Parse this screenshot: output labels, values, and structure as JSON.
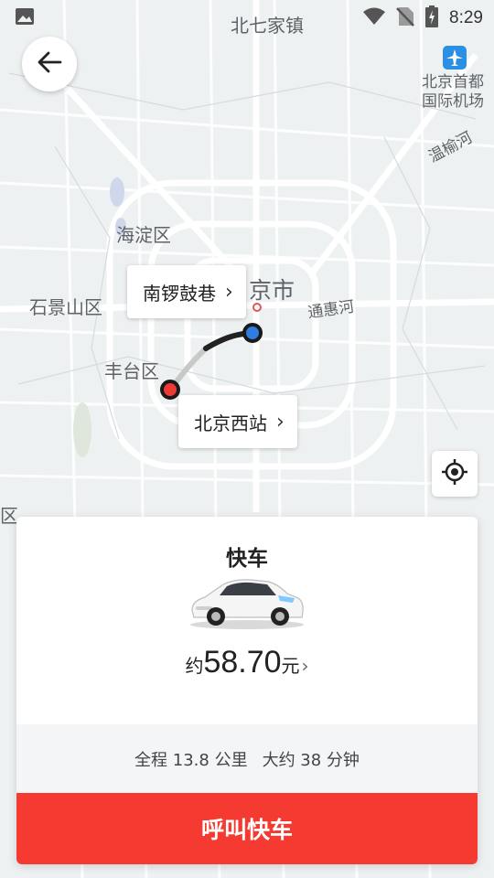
{
  "status_bar": {
    "time": "8:29"
  },
  "map": {
    "labels": {
      "beiqijia": "北七家镇",
      "airport": "北京首都\n国际机场",
      "wenyu": "温榆河",
      "haidian": "海淀区",
      "beijing": "京市",
      "shijingshan": "石景山区",
      "tonghui": "通惠河",
      "fengtai": "丰台区",
      "edge_left": "区"
    }
  },
  "route": {
    "destination_label": "南锣鼓巷",
    "origin_label": "北京西站"
  },
  "card": {
    "title": "快车",
    "price_prefix": "约",
    "price_amount": "58.70",
    "price_unit": "元",
    "distance": "全程 13.8 公里",
    "duration": "大约 38 分钟",
    "call_button": "呼叫快车"
  },
  "colors": {
    "accent": "#f53a31",
    "route_line": "#222222",
    "origin_dot": "#ee3a36",
    "destination_dot": "#2f7de0"
  }
}
